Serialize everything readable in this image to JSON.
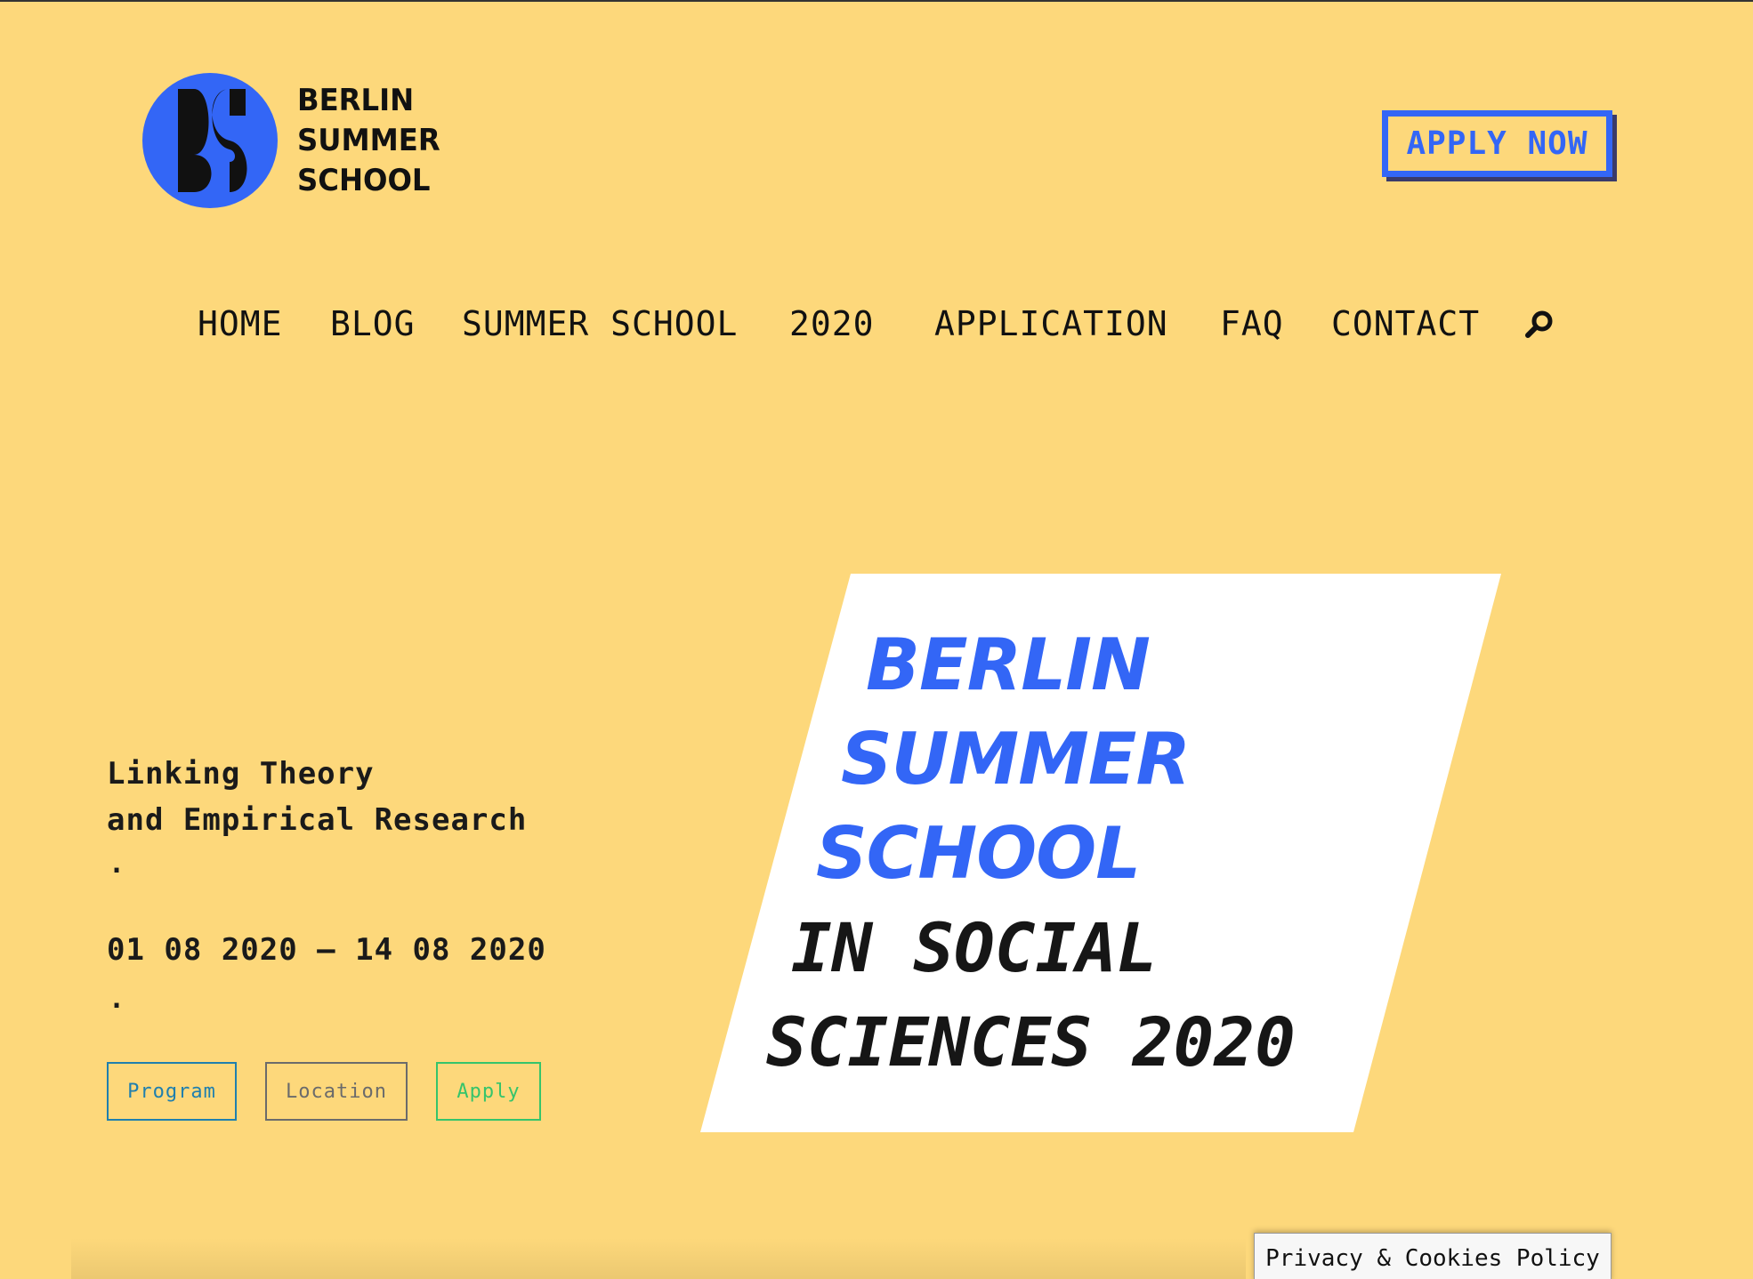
{
  "logo": {
    "line1": "BERLIN",
    "line2": "SUMMER",
    "line3": "SCHOOL"
  },
  "header": {
    "apply_now_label": "APPLY NOW"
  },
  "nav": {
    "items": [
      {
        "label": "HOME"
      },
      {
        "label": "BLOG"
      },
      {
        "label": "SUMMER SCHOOL"
      },
      {
        "label": "2020"
      },
      {
        "label": "APPLICATION"
      },
      {
        "label": "FAQ"
      },
      {
        "label": "CONTACT"
      }
    ],
    "search_icon": "search-icon"
  },
  "hero": {
    "tagline_line1": "Linking Theory",
    "tagline_line2": "and Empirical Research",
    "dot": ".",
    "dates": "01 08 2020 – 14 08 2020",
    "buttons": {
      "program": "Program",
      "location": "Location",
      "apply": "Apply"
    },
    "card": {
      "line1": "BERLIN",
      "line2": "SUMMER",
      "line3": "SCHOOL",
      "line4": "IN SOCIAL",
      "line5": "SCIENCES 2020"
    }
  },
  "footer": {
    "privacy_label": "Privacy & Cookies Policy"
  },
  "colors": {
    "background": "#fdd87b",
    "accent_blue": "#3366f6",
    "program_blue": "#1f7fae",
    "location_gray": "#6b6b6b",
    "apply_green": "#35c46b"
  }
}
